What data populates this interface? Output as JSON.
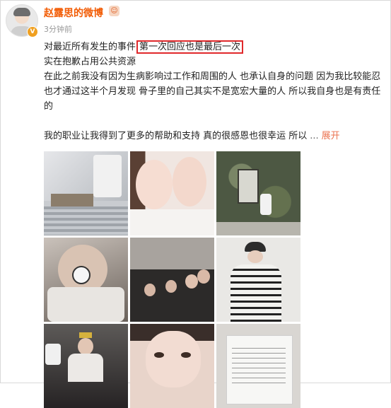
{
  "user": {
    "name": "赵露思的微博",
    "badge": "V",
    "member_icon": "member-emoji-icon",
    "time": "3分钟前"
  },
  "post": {
    "line1_prefix": "对最近所有发生的事件",
    "line1_highlight": "第一次回应也是最后一次",
    "line2": "实在抱歉占用公共资源",
    "line3": "在此之前我没有因为生病影响过工作和周围的人 也承认自身的问题 因为我比较能忍 也才通过这半个月发现 骨子里的自己其实不是宽宏大量的人  所以我自身也是有责任的",
    "line4": "我的职业让我得到了更多的帮助和支持 真的很感恩也很幸运 所以",
    "ellipsis": "...",
    "expand": "展开"
  },
  "photos": [
    {
      "name": "photo-hospital-flowers"
    },
    {
      "name": "photo-two-girls-selfie"
    },
    {
      "name": "photo-ivy-wall"
    },
    {
      "name": "photo-girl-with-pets"
    },
    {
      "name": "photo-group-room"
    },
    {
      "name": "photo-striped-cardigan"
    },
    {
      "name": "photo-birthday-party"
    },
    {
      "name": "photo-closeup-face"
    },
    {
      "name": "photo-document-notes"
    }
  ],
  "colors": {
    "username": "#f25c05",
    "highlight_border": "#e0292b",
    "expand": "#eb7350"
  }
}
